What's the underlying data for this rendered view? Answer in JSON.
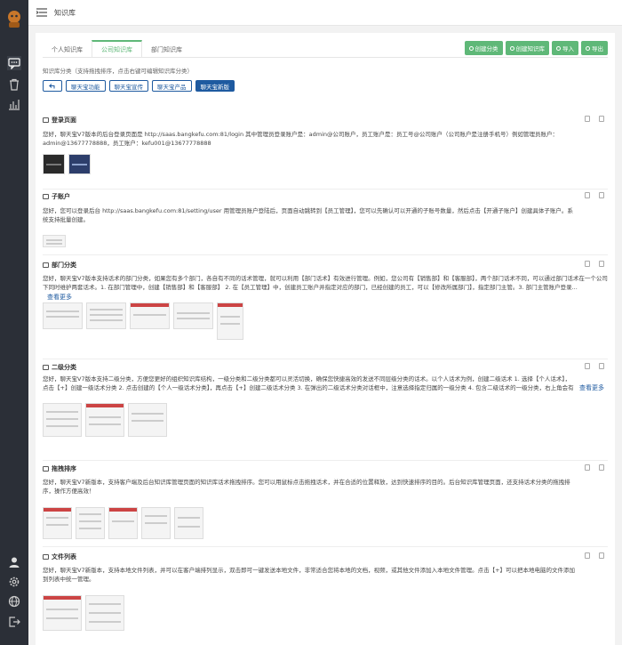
{
  "app": {
    "page_title": "知识库"
  },
  "tabs": [
    {
      "label": "个人知识库"
    },
    {
      "label": "公司知识库"
    },
    {
      "label": "部门知识库"
    }
  ],
  "actions": {
    "create_category": "创建分类",
    "create_kb": "创建知识库",
    "import": "导入",
    "export": "导出"
  },
  "hint": "知识库分类（支持拖拽排序，点击右键可编辑知识库分类）",
  "categories": [
    {
      "label": "聊天宝功能"
    },
    {
      "label": "聊天宝宣传"
    },
    {
      "label": "聊天宝产品"
    },
    {
      "label": "聊天宝新版"
    }
  ],
  "articles": [
    {
      "title": "登录页面",
      "body": "您好，聊天宝V7版本的后台登录页面是 http://saas.bangkefu.com:81/login 其中管理员登录账户是：admin@公司账户，员工账户是：员工号@公司账户（公司账户是注册手机号）例如管理员账户：admin@13677778888，员工账户：kefu001@13677778888"
    },
    {
      "title": "子账户",
      "body": "您好，您可以登录后台 http://saas.bangkefu.com:81/setting/user 用管理员账户登陆后，页面自动跳转到【员工管理】，您可以先确认可以开通的子账号数量，然后点击【开通子账户】创建具体子账户。系统支持批量创建。"
    },
    {
      "title": "部门分类",
      "body": "您好，聊天宝V7版本支持话术的部门分类，如果您有多个部门，各自有不同的话术管理，就可以利用【部门话术】有效进行管理。例如，您公司有【销售部】和【客服部】，两个部门话术不同，可以通过部门话术在一个公司下同时维护两套话术。1. 在部门管理中，创建【销售部】和【客服部】 2. 在【员工管理】中，创建员工账户并指定对应的部门，已经创建的员工，可以【修改所属部门】，指定部门主管。3. 部门主管账户登录...",
      "more": "查看更多"
    },
    {
      "title": "二级分类",
      "body": "您好，聊天宝V7版本支持二级分类，方便您更好的组织知识库结构，一级分类和二级分类都可以灵活切换，确保您快捷高效的发送不同层级分类的话术。以个人话术为例，创建二级话术 1. 选择【个人话术】，点击【+】创建一级话术分类 2. 点击创建的【个人一级话术分类】，再点击【+】创建二级话术分类 3. 在弹出的二级话术分类对话框中，注意选择指定归属的一级分类 4. 包含二级话术的一级分类，右上角会有自色三角...",
      "more": "查看更多"
    },
    {
      "title": "拖拽排序",
      "body": "您好，聊天宝V7新版本，支持客户端及后台知识库管理页面的知识库话术拖拽排序。您可以用鼠标点击拖拽话术，并在合适的位置释放，达到快速排序的目的。后台知识库管理页面，还支持话术分类的拖拽排序，操作方便高效！"
    },
    {
      "title": "文件列表",
      "body": "您好，聊天宝V7新版本，支持本地文件列表，并可以在客户端排列显示，双击即可一键发送本地文件，非常适合您将本地的文档，视频，或其他文件添加入本地文件管理。点击【+】可以把本地电脑的文件添加到列表中统一管理。"
    }
  ],
  "colors": {
    "sidebar": "#2b2f37",
    "accent_green": "#5fb878",
    "accent_blue": "#1e5aa0"
  }
}
